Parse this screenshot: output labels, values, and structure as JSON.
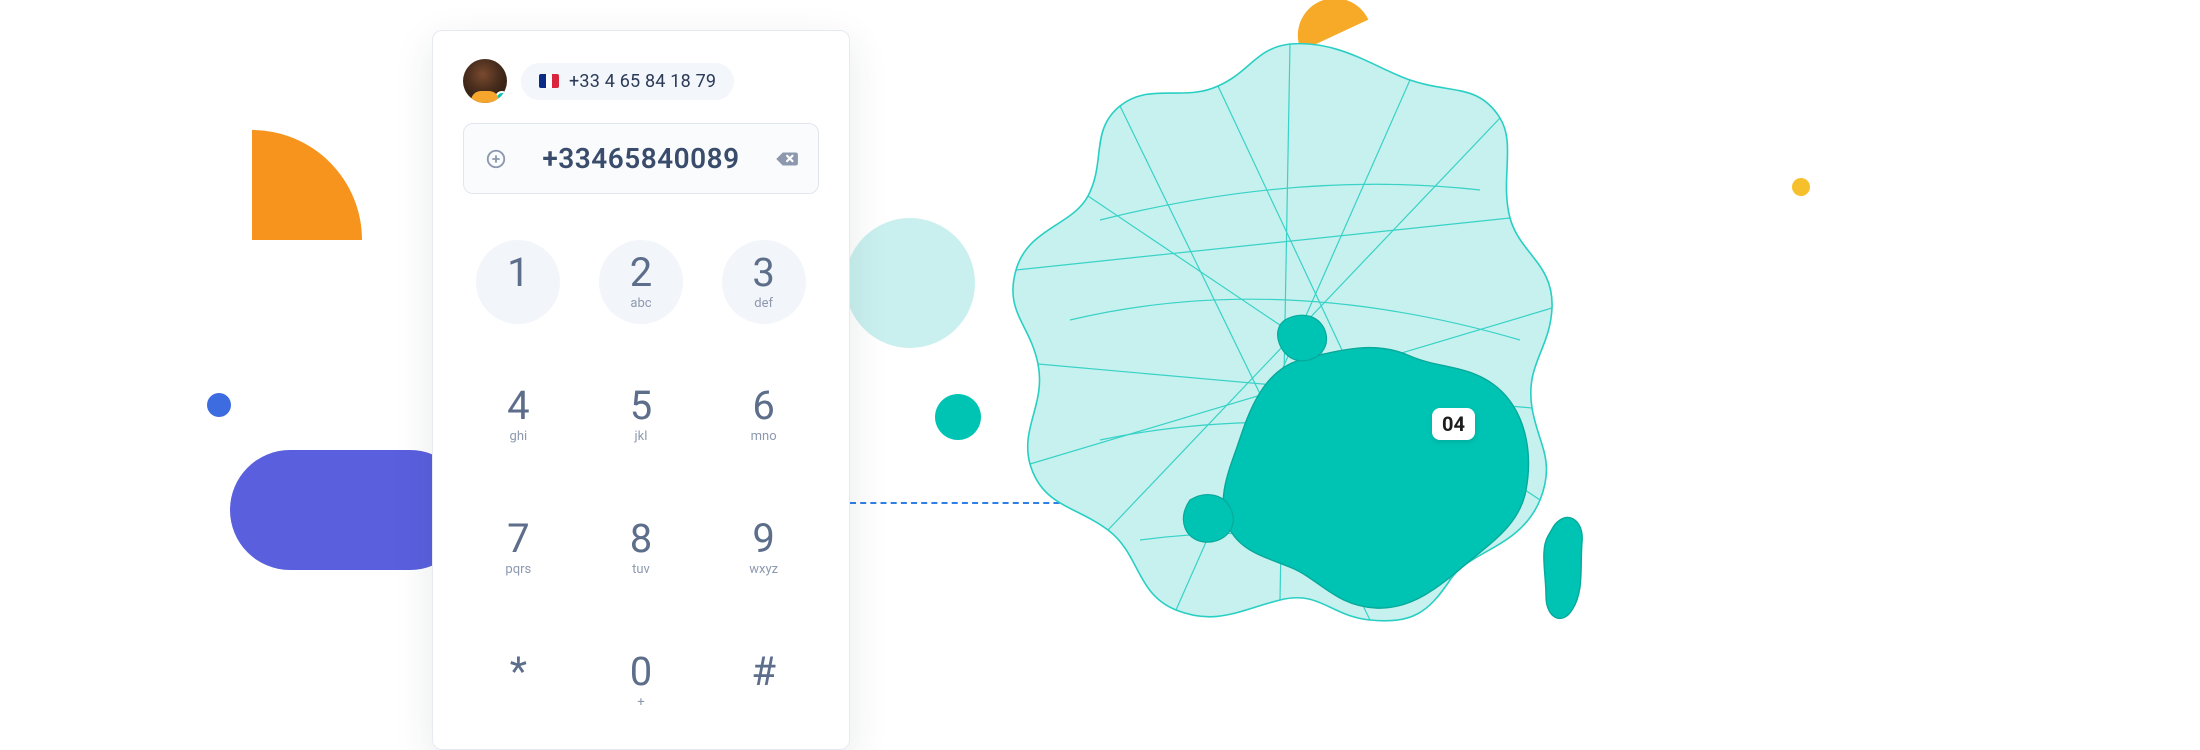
{
  "contact": {
    "origin_number": "+33 4 65 84 18 79",
    "flag": "fr"
  },
  "input": {
    "value": "+33465840089"
  },
  "keypad": [
    {
      "digit": "1",
      "letters": ""
    },
    {
      "digit": "2",
      "letters": "abc"
    },
    {
      "digit": "3",
      "letters": "def"
    },
    {
      "digit": "4",
      "letters": "ghi"
    },
    {
      "digit": "5",
      "letters": "jkl"
    },
    {
      "digit": "6",
      "letters": "mno"
    },
    {
      "digit": "7",
      "letters": "pqrs"
    },
    {
      "digit": "8",
      "letters": "tuv"
    },
    {
      "digit": "9",
      "letters": "wxyz"
    },
    {
      "digit": "*",
      "letters": ""
    },
    {
      "digit": "0",
      "letters": "+"
    },
    {
      "digit": "#",
      "letters": ""
    }
  ],
  "map": {
    "region_code": "04"
  },
  "colors": {
    "map_light": "#c7f1ee",
    "map_border": "#29cfc3",
    "map_highlight": "#00c4b3",
    "accent_indigo": "#5a5fde",
    "accent_orange": "#f7941d"
  }
}
